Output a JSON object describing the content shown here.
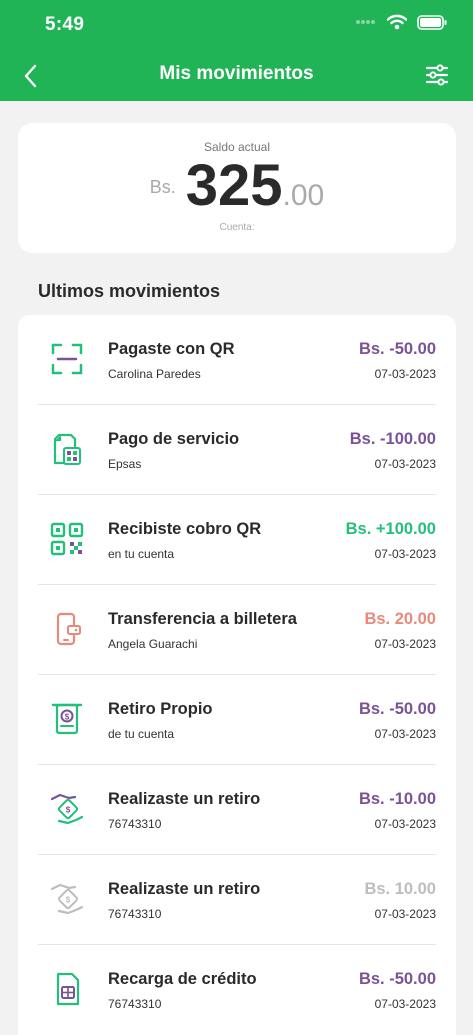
{
  "status": {
    "time": "5:49"
  },
  "header": {
    "title": "Mis movimientos"
  },
  "balance": {
    "label": "Saldo actual",
    "currency": "Bs.",
    "integer": "325",
    "decimal": ".00",
    "account_label": "Cuenta:"
  },
  "section": {
    "title": "Ultimos movimientos"
  },
  "colors": {
    "brand": "#21b457",
    "negative": "#7a5296",
    "positive": "#22c07a",
    "transfer": "#e9897b",
    "muted": "#bdbdbd"
  },
  "transactions": [
    {
      "title": "Pagaste con QR",
      "sub": "Carolina Paredes",
      "amount": "Bs. -50.00",
      "date": "07-03-2023",
      "icon": "qr-scan-icon"
    },
    {
      "title": "Pago de servicio",
      "sub": "Epsas",
      "amount": "Bs. -100.00",
      "date": "07-03-2023",
      "icon": "service-bill-icon"
    },
    {
      "title": "Recibiste cobro QR",
      "sub": "en tu cuenta",
      "amount": "Bs. +100.00",
      "date": "07-03-2023",
      "icon": "qr-code-icon"
    },
    {
      "title": "Transferencia a billetera",
      "sub": "Angela Guarachi",
      "amount": "Bs. 20.00",
      "date": "07-03-2023",
      "icon": "wallet-transfer-icon"
    },
    {
      "title": "Retiro Propio",
      "sub": "de tu cuenta",
      "amount": "Bs. -50.00",
      "date": "07-03-2023",
      "icon": "atm-withdraw-icon"
    },
    {
      "title": "Realizaste un retiro",
      "sub": "76743310",
      "amount": "Bs. -10.00",
      "date": "07-03-2023",
      "icon": "hand-money-icon"
    },
    {
      "title": "Realizaste un retiro",
      "sub": "76743310",
      "amount": "Bs. 10.00",
      "date": "07-03-2023",
      "icon": "hand-money-icon"
    },
    {
      "title": "Recarga de crédito",
      "sub": "76743310",
      "amount": "Bs. -50.00",
      "date": "07-03-2023",
      "icon": "sim-card-icon"
    }
  ]
}
